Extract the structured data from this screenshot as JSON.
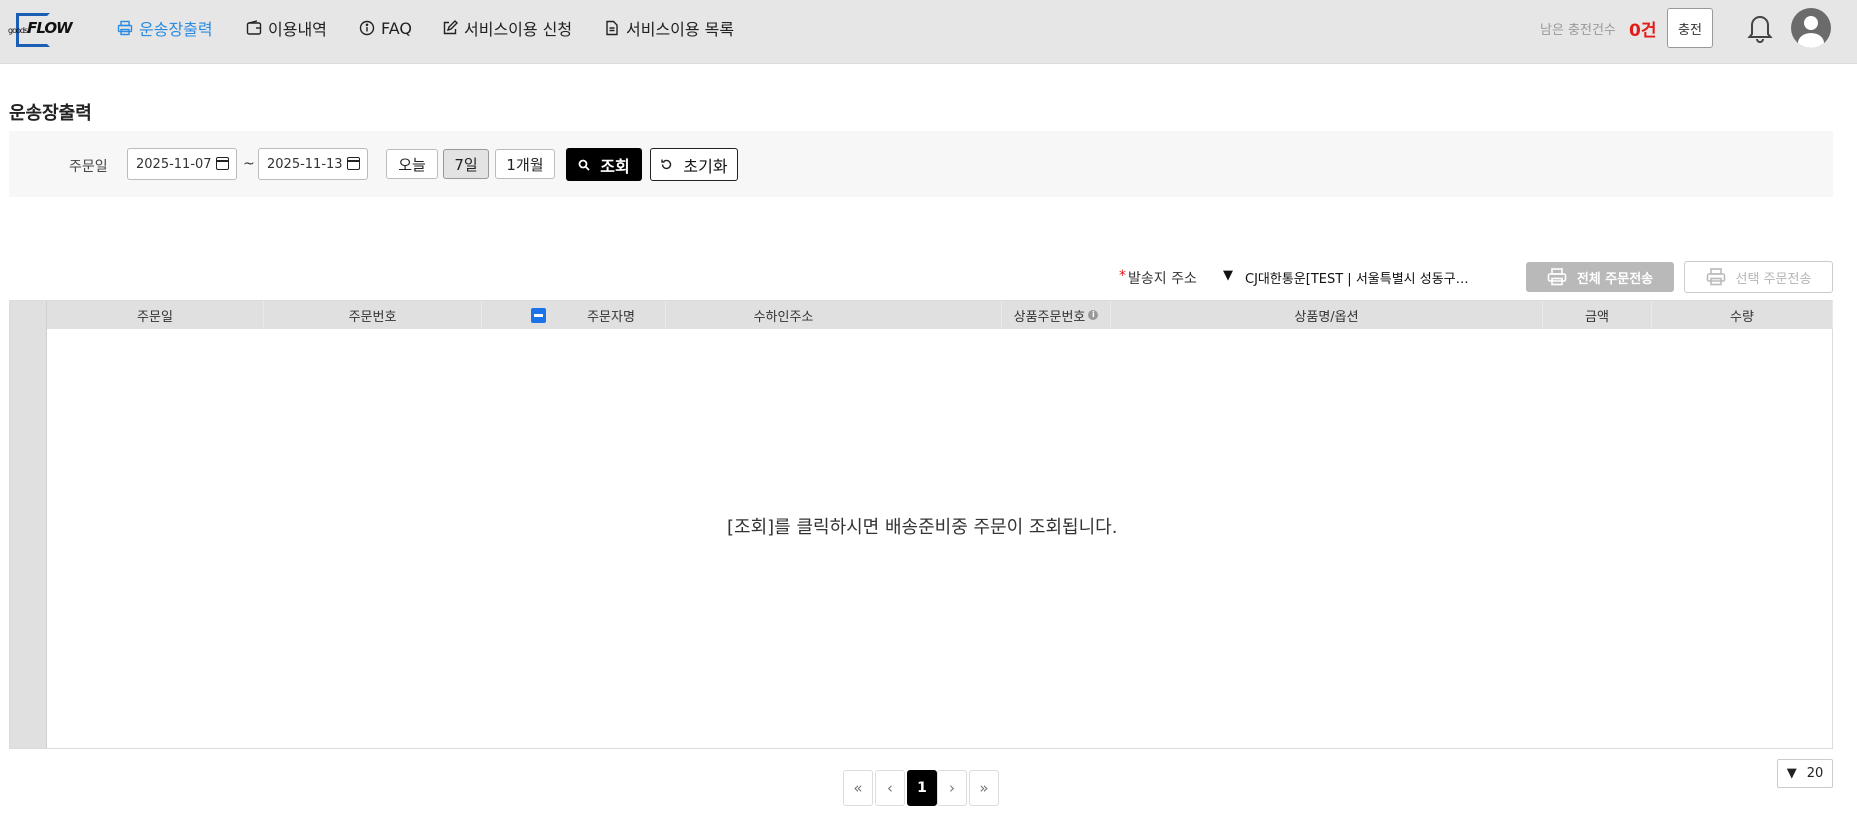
{
  "header": {
    "logo_small": "goods",
    "logo_main": "FLOW",
    "nav": [
      {
        "label": "운송장출력",
        "icon": "printer-icon"
      },
      {
        "label": "이용내역",
        "icon": "wallet-icon"
      },
      {
        "label": "FAQ",
        "icon": "info-circle-icon"
      },
      {
        "label": "서비스이용 신청",
        "icon": "edit-icon"
      },
      {
        "label": "서비스이용 목록",
        "icon": "document-icon"
      }
    ],
    "remain_label": "남은 충전건수",
    "remain_count": "0건",
    "charge_label": "충전",
    "accent_color": "#2a8be0"
  },
  "page_title": "운송장출력",
  "filter": {
    "order_date_label": "주문일",
    "date_from": "2025-11-07",
    "date_to": "2025-11-13",
    "separator": "~",
    "range_buttons": [
      "오늘",
      "7일",
      "1개월"
    ],
    "selected_range": "7일",
    "search_label": "조회",
    "reset_label": "초기화"
  },
  "shipping": {
    "required_mark": "*",
    "label": "발송지 주소",
    "selected": "CJ대한통운[TEST | 서울특별시 성동구…"
  },
  "actions": {
    "send_all": "전체 주문전송",
    "send_selected": "선택 주문전송"
  },
  "table": {
    "columns": [
      "주문일",
      "주문번호",
      "주문자명",
      "수하인주소",
      "상품주문번호",
      "상품명/옵션",
      "금액",
      "수량"
    ],
    "empty_message": "[조회]를 클릭하시면 배송준비중 주문이 조회됩니다."
  },
  "pagination": {
    "first": "«",
    "prev": "‹",
    "current": "1",
    "next": "›",
    "last": "»",
    "page_size": "20"
  }
}
